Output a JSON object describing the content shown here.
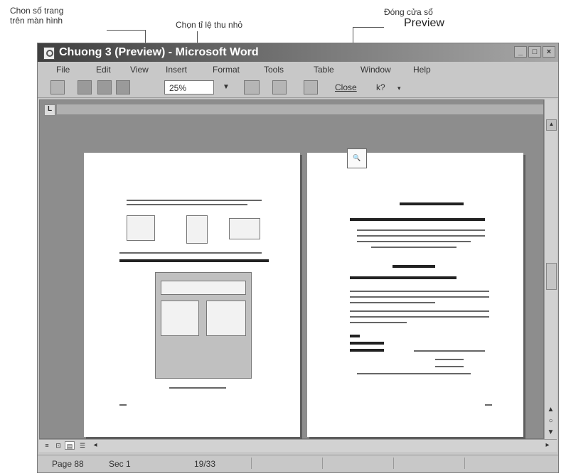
{
  "callouts": {
    "page_count": "Chon số trang\ntrên màn hình",
    "zoom": "Chọn tỉ lệ thu nhỏ",
    "close_label": "Đóng cửa sổ",
    "close_label_big": "Preview"
  },
  "window": {
    "title": "Chuong 3 (Preview) - Microsoft Word"
  },
  "menu": [
    "File",
    "Edit",
    "View",
    "Insert",
    "Format",
    "Tools",
    "Table",
    "Window",
    "Help"
  ],
  "toolbar": {
    "zoom_value": "25%",
    "close_label": "Close",
    "help_label": "k?"
  },
  "statusbar": {
    "page": "Page 88",
    "sec": "Sec 1",
    "pages": "19/33"
  },
  "colors": {
    "window_bg": "#c8c8c8",
    "preview_bg": "#8d8d8d",
    "page_bg": "#ffffff"
  }
}
